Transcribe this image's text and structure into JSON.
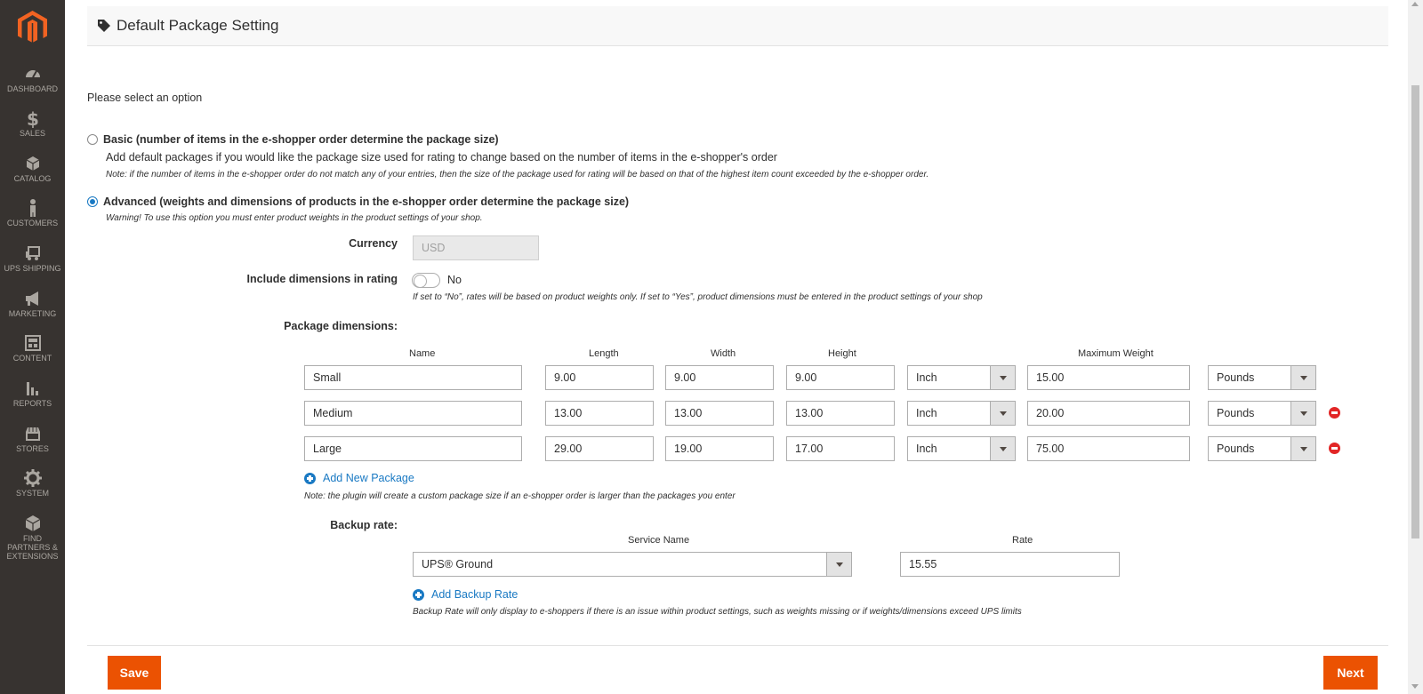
{
  "nav": [
    {
      "label": "Dashboard",
      "icon": "dashboard-icon"
    },
    {
      "label": "Sales",
      "icon": "dollar-icon"
    },
    {
      "label": "Catalog",
      "icon": "box-icon"
    },
    {
      "label": "Customers",
      "icon": "person-icon"
    },
    {
      "label": "UPS Shipping",
      "icon": "truck-icon"
    },
    {
      "label": "Marketing",
      "icon": "megaphone-icon"
    },
    {
      "label": "Content",
      "icon": "layout-icon"
    },
    {
      "label": "Reports",
      "icon": "bar-chart-icon"
    },
    {
      "label": "Stores",
      "icon": "store-icon"
    },
    {
      "label": "System",
      "icon": "gear-icon"
    },
    {
      "label": "Find Partners & Extensions",
      "icon": "cube-icon"
    }
  ],
  "header": {
    "title": "Default Package Setting"
  },
  "intro": "Please select an option",
  "options": {
    "basic": {
      "title": "Basic (number of items in the e-shopper order determine the package size)",
      "desc": "Add default packages if you would like the package size used for rating to change based on the number of items in the e-shopper's order",
      "note": "Note: if the number of items in the e-shopper order do not match any of your entries, then the size of the package used for rating will be based on that of the highest item count exceeded by the e-shopper order.",
      "selected": false
    },
    "advanced": {
      "title": "Advanced (weights and dimensions of products in the e-shopper order determine the package size)",
      "note": "Warning! To use this option you must enter product weights in the product settings of your shop.",
      "selected": true
    }
  },
  "currency": {
    "label": "Currency",
    "value": "USD"
  },
  "dimensions_toggle": {
    "label": "Include dimensions in rating",
    "value": "No",
    "note": "If set to “No”, rates will be based on product weights only.  If set to “Yes”, product dimensions must be entered in the product settings of your shop"
  },
  "packages": {
    "label": "Package dimensions:",
    "headers": {
      "name": "Name",
      "length": "Length",
      "width": "Width",
      "height": "Height",
      "max_weight": "Maximum Weight"
    },
    "rows": [
      {
        "name": "Small",
        "length": "9.00",
        "width": "9.00",
        "height": "9.00",
        "unit": "Inch",
        "weight": "15.00",
        "weight_unit": "Pounds"
      },
      {
        "name": "Medium",
        "length": "13.00",
        "width": "13.00",
        "height": "13.00",
        "unit": "Inch",
        "weight": "20.00",
        "weight_unit": "Pounds"
      },
      {
        "name": "Large",
        "length": "29.00",
        "width": "19.00",
        "height": "17.00",
        "unit": "Inch",
        "weight": "75.00",
        "weight_unit": "Pounds"
      }
    ],
    "add_label": "Add New Package",
    "note": "Note: the plugin will create a custom package size if an e-shopper order is larger than the packages you enter"
  },
  "backup": {
    "label": "Backup rate:",
    "service_header": "Service Name",
    "rate_header": "Rate",
    "service": "UPS® Ground",
    "rate": "15.55",
    "add_label": "Add Backup Rate",
    "note": "Backup Rate will only display to e-shoppers if there is an issue within product settings, such as weights missing or if weights/dimensions exceed UPS limits"
  },
  "buttons": {
    "save": "Save",
    "next": "Next"
  },
  "colors": {
    "accent": "#eb5202",
    "link": "#1979c3",
    "sidebar": "#373330",
    "remove": "#e22626"
  }
}
